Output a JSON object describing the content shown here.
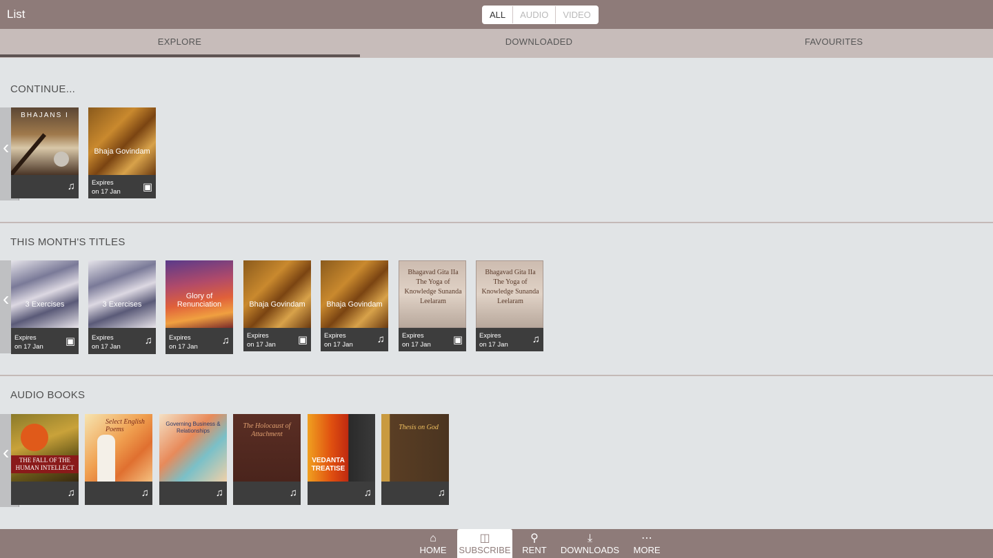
{
  "header": {
    "title": "List"
  },
  "filter": {
    "all": "ALL",
    "audio": "AUDIO",
    "video": "VIDEO"
  },
  "tabs": {
    "explore": "EXPLORE",
    "downloaded": "DOWNLOADED",
    "favourites": "FAVOURITES"
  },
  "sections": {
    "continue": {
      "heading": "CONTINUE...",
      "items": [
        {
          "cover_text": "BHAJANS I",
          "expires_1": "",
          "expires_2": "",
          "kind": "audio"
        },
        {
          "cover_text": "Bhaja Govindam",
          "expires_1": "Expires",
          "expires_2": "on 17 Jan",
          "kind": "video"
        }
      ]
    },
    "month": {
      "heading": "THIS MONTH'S TITLES",
      "items": [
        {
          "cover_text": "3 Exercises",
          "expires_1": "Expires",
          "expires_2": "on 17 Jan",
          "kind": "video"
        },
        {
          "cover_text": "3 Exercises",
          "expires_1": "Expires",
          "expires_2": "on 17 Jan",
          "kind": "audio"
        },
        {
          "cover_text": "Glory of Renunciation",
          "expires_1": "Expires",
          "expires_2": "on 17 Jan",
          "kind": "audio"
        },
        {
          "cover_text": "Bhaja Govindam",
          "expires_1": "Expires",
          "expires_2": "on 17 Jan",
          "kind": "video"
        },
        {
          "cover_text": "Bhaja Govindam",
          "expires_1": "Expires",
          "expires_2": "on 17 Jan",
          "kind": "audio"
        },
        {
          "cover_text": "Bhagavad Gita IIa The Yoga of Knowledge Sunanda Leelaram",
          "expires_1": "Expires",
          "expires_2": "on 17 Jan",
          "kind": "video"
        },
        {
          "cover_text": "Bhagavad Gita IIa The Yoga of Knowledge Sunanda Leelaram",
          "expires_1": "Expires",
          "expires_2": "on 17 Jan",
          "kind": "audio"
        }
      ]
    },
    "audiobooks": {
      "heading": "AUDIO BOOKS",
      "items": [
        {
          "cover_text": "THE FALL OF THE HUMAN INTELLECT",
          "kind": "audio"
        },
        {
          "cover_text": "Select English Poems",
          "kind": "audio"
        },
        {
          "cover_text": "Governing Business & Relationships",
          "kind": "audio"
        },
        {
          "cover_text": "The Holocaust of Attachment",
          "kind": "audio"
        },
        {
          "cover_text": "VEDANTA TREATISE",
          "kind": "audio"
        },
        {
          "cover_text": "Thesis on God",
          "kind": "audio"
        }
      ]
    }
  },
  "bottom_nav": {
    "home": "HOME",
    "subscribe": "SUBSCRIBE",
    "rent": "RENT",
    "downloads": "DOWNLOADS",
    "more": "MORE"
  },
  "icons": {
    "audio": "music-note-icon",
    "video": "film-icon",
    "left_arrow": "chevron-left-icon"
  },
  "colors": {
    "bar": "#8e7b79",
    "tabs": "#c7bcba",
    "background": "#e1e4e6",
    "card_meta": "#3d3d3d"
  }
}
